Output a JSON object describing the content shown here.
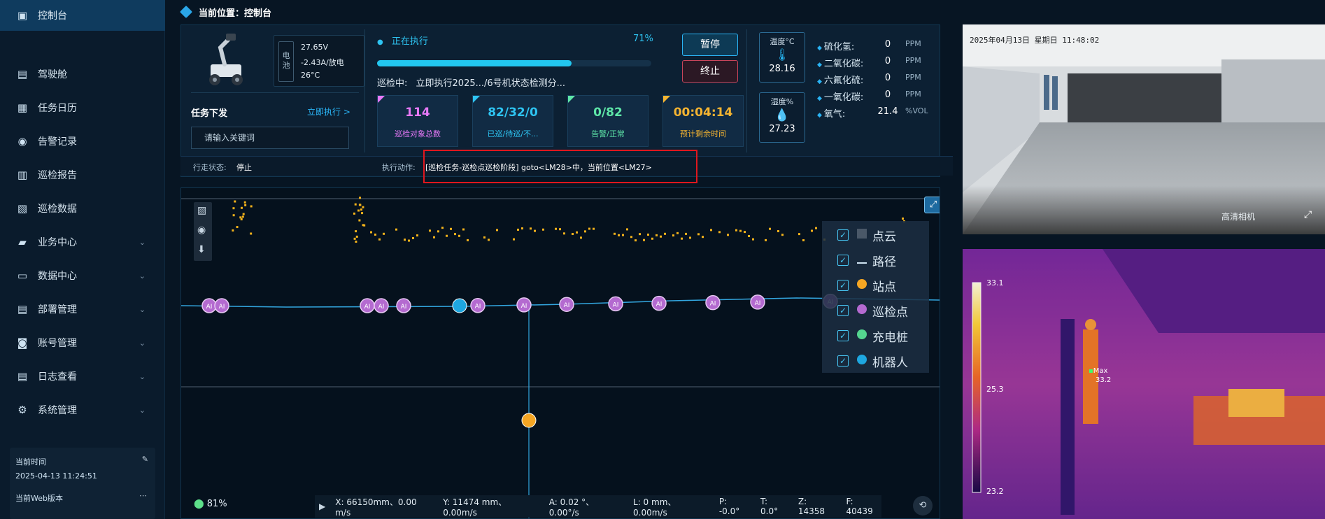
{
  "sidebar": {
    "items": [
      {
        "label": "控制台",
        "icon": "dashboard-icon",
        "active": true
      },
      {
        "label": "驾驶舱",
        "icon": "cockpit-icon"
      },
      {
        "label": "任务日历",
        "icon": "calendar-icon"
      },
      {
        "label": "告警记录",
        "icon": "alarm-icon"
      },
      {
        "label": "巡检报告",
        "icon": "report-icon"
      },
      {
        "label": "巡检数据",
        "icon": "data-icon"
      },
      {
        "label": "业务中心",
        "icon": "folder-icon",
        "expandable": true
      },
      {
        "label": "数据中心",
        "icon": "monitor-icon",
        "expandable": true
      },
      {
        "label": "部署管理",
        "icon": "deploy-icon",
        "expandable": true
      },
      {
        "label": "账号管理",
        "icon": "account-icon",
        "expandable": true
      },
      {
        "label": "日志查看",
        "icon": "log-icon",
        "expandable": true
      },
      {
        "label": "系统管理",
        "icon": "settings-icon",
        "expandable": true
      }
    ],
    "footer": {
      "time_label": "当前时间",
      "time_value": "2025-04-13 11:24:51",
      "version_label": "当前Web版本"
    }
  },
  "breadcrumb": {
    "text": "当前位置：控制台"
  },
  "robot": {
    "battery_label": "电池",
    "voltage": "27.65V",
    "current": "-2.43A/放电",
    "temperature": "26°C"
  },
  "task": {
    "title": "任务下发",
    "exec_link": "立即执行 >",
    "search_placeholder": "请输入关键词"
  },
  "execution": {
    "status": "正在执行",
    "progress_text": "71%",
    "progress": 0.71,
    "inspect_label": "巡检中:",
    "inspect_value": "立即执行2025.../6号机状态检测分..."
  },
  "stats": [
    {
      "value": "114",
      "label": "巡检对象总数",
      "color": "#e879f9"
    },
    {
      "value": "82/32/0",
      "label": "已巡/待巡/不...",
      "color": "#2ec4f2"
    },
    {
      "value": "0/82",
      "label": "告警/正常",
      "color": "#5ee6a8"
    },
    {
      "value": "00:04:14",
      "label": "预计剩余时间",
      "color": "#f5b431"
    }
  ],
  "controls": {
    "pause": "暂停",
    "stop": "终止"
  },
  "environment": {
    "temp_label": "温度°C",
    "temp_value": "28.16",
    "humidity_label": "湿度%",
    "humidity_value": "27.23"
  },
  "gases": [
    {
      "name": "硫化氢:",
      "value": "0",
      "unit": "PPM"
    },
    {
      "name": "二氧化碳:",
      "value": "0",
      "unit": "PPM"
    },
    {
      "name": "六氟化硫:",
      "value": "0",
      "unit": "PPM"
    },
    {
      "name": "一氧化碳:",
      "value": "0",
      "unit": "PPM"
    },
    {
      "name": "氧气:",
      "value": "21.4",
      "unit": "%VOL"
    }
  ],
  "status_bar": {
    "walk_label": "行走状态:",
    "walk_value": "停止",
    "action_label": "执行动作:",
    "action_value": "[巡检任务-巡检点巡检阶段] goto<LM28>中，当前位置<LM27>"
  },
  "map": {
    "signal": "81%",
    "legend": [
      {
        "label": "点云",
        "checked": true
      },
      {
        "label": "路径",
        "checked": true
      },
      {
        "label": "站点",
        "checked": true
      },
      {
        "label": "巡检点",
        "checked": true
      },
      {
        "label": "充电桩",
        "checked": true
      },
      {
        "label": "机器人",
        "checked": true
      }
    ],
    "node_label": "AI",
    "coords": {
      "x": "X: 66150mm、0.00 m/s",
      "y": "Y: 11474 mm、0.00m/s",
      "a": "A: 0.02 °、0.00°/s",
      "l": "L: 0 mm、0.00m/s",
      "p": "P: -0.0°",
      "t": "T: 0.0°",
      "z": "Z: 14358",
      "f": "F: 40439"
    }
  },
  "camera": {
    "timestamp": "2025年04月13日 星期日 11:48:02",
    "quality_label": "高清相机"
  },
  "thermal": {
    "scale_max": "33.1",
    "scale_mid": "25.3",
    "scale_min": "23.2",
    "max_label": "Max",
    "max_value": "33.2"
  }
}
